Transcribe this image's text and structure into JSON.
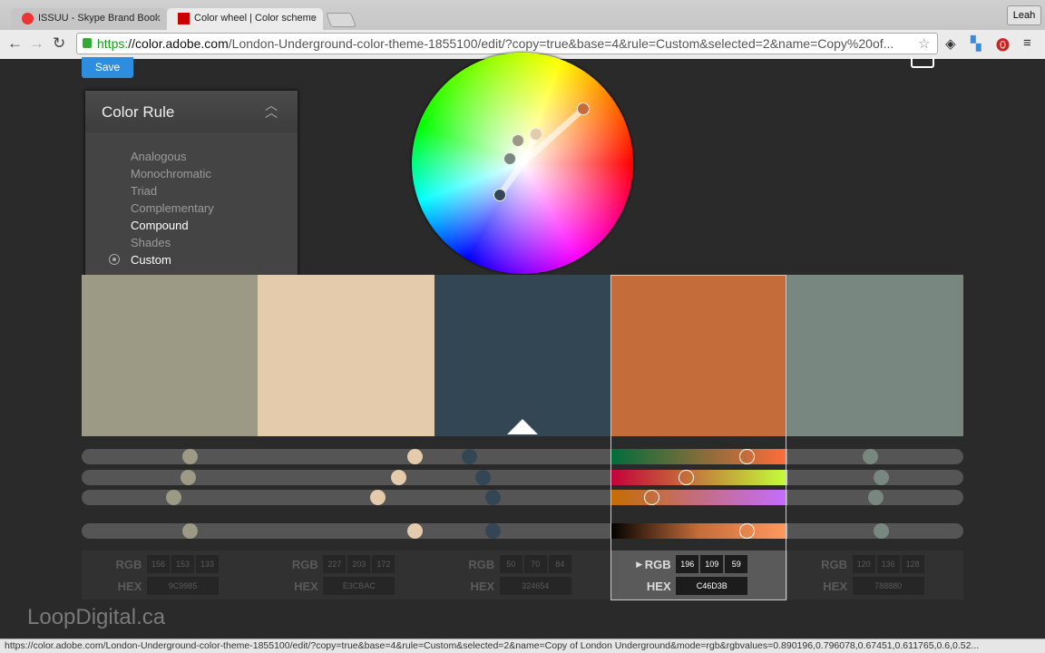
{
  "browser": {
    "tabs": [
      {
        "title": "ISSUU - Skype Brand Book",
        "active": false
      },
      {
        "title": "Color wheel | Color scheme",
        "active": true
      }
    ],
    "user": "Leah",
    "url_scheme": "https:",
    "url_domain": "//color.adobe.com",
    "url_path": "/London-Underground-color-theme-1855100/edit/?copy=true&base=4&rule=Custom&selected=2&name=Copy%20of...",
    "status_url": "https://color.adobe.com/London-Underground-color-theme-1855100/edit/?copy=true&base=4&rule=Custom&selected=2&name=Copy of London Underground&mode=rgb&rgbvalues=0.890196,0.796078,0.67451,0.611765,0.6,0.52..."
  },
  "page": {
    "save_label": "Save",
    "color_rule": {
      "title": "Color Rule",
      "items": [
        "Analogous",
        "Monochromatic",
        "Triad",
        "Complementary",
        "Compound",
        "Shades",
        "Custom"
      ],
      "selected": "Custom",
      "hovered": "Compound"
    },
    "selected_index": 3,
    "base_index": 2,
    "rgb_label": "RGB",
    "hex_label": "HEX",
    "colors": [
      {
        "hex": "9C9985",
        "rgb": [
          156,
          153,
          133
        ]
      },
      {
        "hex": "E3CBAC",
        "rgb": [
          227,
          203,
          172
        ]
      },
      {
        "hex": "324654",
        "rgb": [
          50,
          70,
          84
        ]
      },
      {
        "hex": "C46D3B",
        "rgb": [
          196,
          109,
          59
        ]
      },
      {
        "hex": "788880",
        "rgb": [
          120,
          136,
          128
        ]
      }
    ],
    "watermark": "LoopDigital.ca"
  }
}
